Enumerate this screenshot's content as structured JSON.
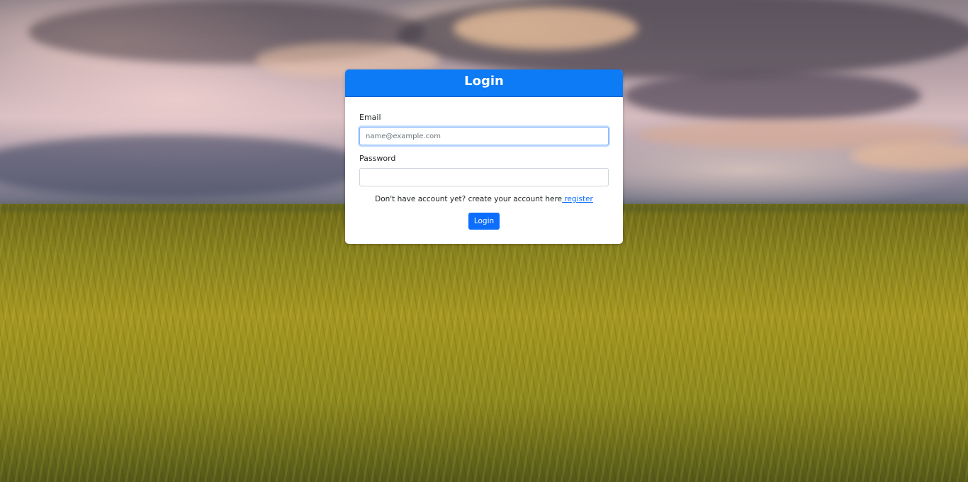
{
  "login_card": {
    "title": "Login",
    "email": {
      "label": "Email",
      "placeholder": "name@example.com",
      "value": ""
    },
    "password": {
      "label": "Password",
      "value": ""
    },
    "register_text": "Don't have account yet? create your account here",
    "register_link": " register",
    "submit_label": "Login"
  },
  "colors": {
    "header_blue": "#0d7bf5",
    "button_blue": "#0d6efd",
    "link_blue": "#0d6efd"
  }
}
